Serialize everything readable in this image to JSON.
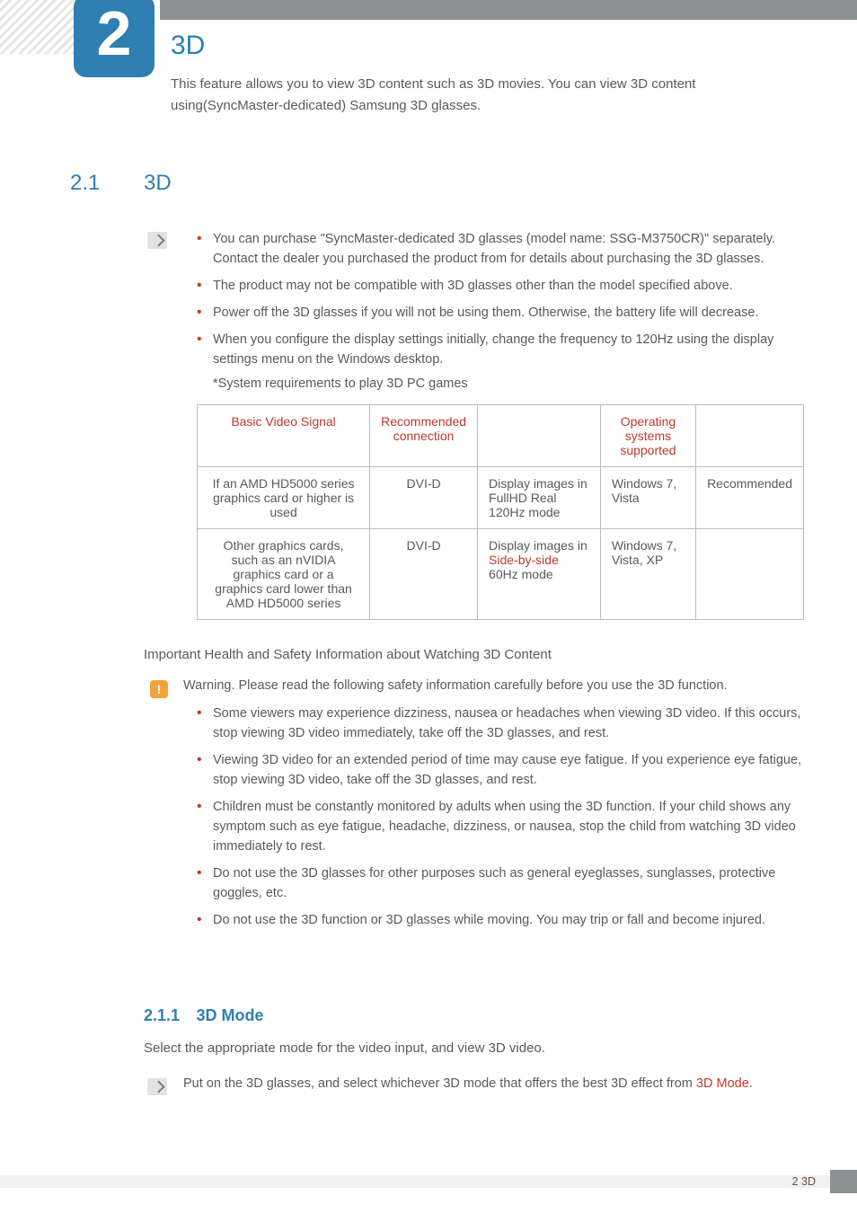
{
  "chapter": {
    "number": "2",
    "title": "3D",
    "intro": "This feature allows you to view 3D content such as 3D movies. You can view 3D content using(SyncMaster-dedicated) Samsung 3D glasses."
  },
  "section": {
    "number": "2.1",
    "title": "3D"
  },
  "notes1": {
    "items": [
      "You can purchase \"SyncMaster-dedicated 3D glasses (model name: SSG-M3750CR)\" separately. Contact the dealer you purchased the product from for details about purchasing the 3D glasses.",
      "The product may not be compatible with 3D glasses other than the model specified above.",
      "Power off the 3D glasses if you will not be using them. Otherwise, the battery life will decrease.",
      "When you configure the display settings initially, change the frequency to 120Hz using the display settings menu on the Windows desktop."
    ],
    "subnote": "*System requirements to play 3D PC games"
  },
  "table": {
    "headers": {
      "c1": "Basic Video Signal",
      "c2": "Recommended connection",
      "c3": "",
      "c4": "Operating systems supported",
      "c5": ""
    },
    "rows": [
      {
        "c1": "If an AMD HD5000 series graphics card or higher is used",
        "c2": "DVI-D",
        "c3a": "Display images in FullHD Real 120Hz mode",
        "c3hl": "",
        "c3b": "",
        "c4": "Windows 7, Vista",
        "c5": "Recommended"
      },
      {
        "c1": "Other graphics cards, such as an nVIDIA graphics card or a graphics card lower than AMD HD5000 series",
        "c2": "DVI-D",
        "c3a": "Display images in ",
        "c3hl": "Side-by-side",
        "c3b": " 60Hz mode",
        "c4": "Windows 7, Vista, XP",
        "c5": ""
      }
    ]
  },
  "health": {
    "heading": "Important Health and Safety Information about Watching 3D Content",
    "lead": "Warning. Please read the following safety information carefully before you use the 3D function.",
    "items": [
      "Some viewers may experience dizziness, nausea or headaches when viewing 3D video. If this occurs, stop viewing 3D video immediately, take off the 3D glasses, and rest.",
      "Viewing 3D video for an extended period of time may cause eye fatigue. If you experience eye fatigue, stop viewing 3D video, take off the 3D glasses, and rest.",
      "Children must be constantly monitored by adults when using the 3D function. If your child shows any symptom such as eye fatigue, headache, dizziness, or nausea, stop the child from watching 3D video immediately to rest.",
      "Do not use the 3D glasses for other purposes such as general eyeglasses, sunglasses, protective goggles, etc.",
      "Do not use the 3D function or 3D glasses while moving. You may trip or fall and become injured."
    ]
  },
  "subsection": {
    "number": "2.1.1",
    "title": "3D Mode",
    "body": "Select the appropriate mode for the video input, and view 3D video.",
    "note_a": "Put on the 3D glasses, and select whichever 3D mode that offers the best 3D effect from ",
    "note_hl": "3D Mode",
    "note_b": "."
  },
  "footer": {
    "label": "2 3D"
  }
}
